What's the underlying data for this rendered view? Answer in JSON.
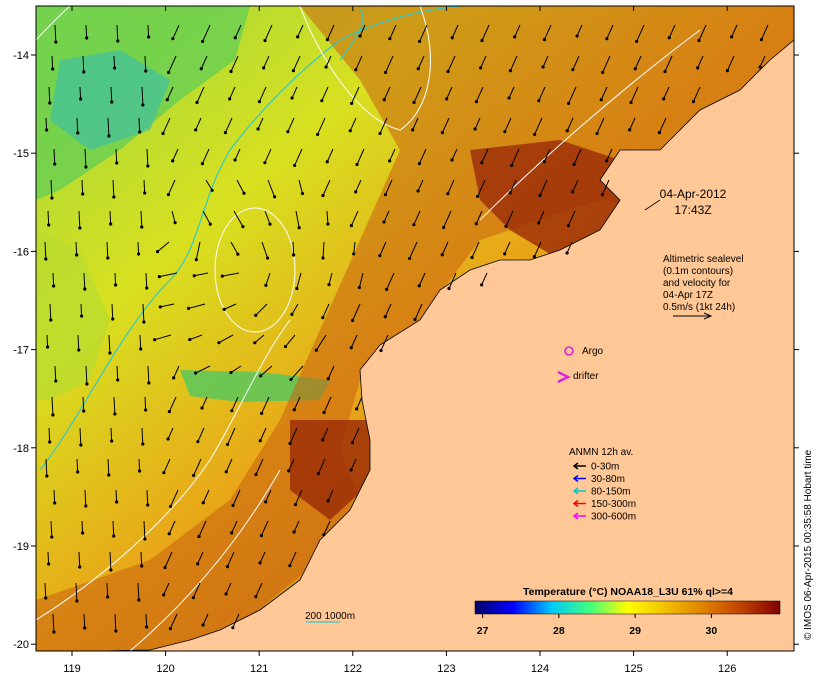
{
  "map": {
    "lon_ticks": [
      "119",
      "120",
      "121",
      "122",
      "123",
      "124",
      "125",
      "126"
    ],
    "lat_ticks": [
      "-14",
      "-15",
      "-16",
      "-17",
      "-18",
      "-19",
      "-20"
    ],
    "date_label": "04-Apr-2012",
    "time_label": "17:43Z",
    "altimetry_note": [
      "Altimetric sealevel",
      "(0.1m contours)",
      "and velocity for",
      "04-Apr 17Z",
      "0.5m/s (1kt 24h)"
    ],
    "argo_label": "Argo",
    "drifter_label": "drifter",
    "isobath_label": "200  1000m",
    "credit": "© IMOS 06-Apr-2015 00:35:58 Hobart time"
  },
  "anmn_legend": {
    "title": "ANMN 12h av.",
    "items": [
      {
        "label": "0-30m",
        "color": "#000000"
      },
      {
        "label": "30-80m",
        "color": "#0000ff"
      },
      {
        "label": "80-150m",
        "color": "#00c8c8"
      },
      {
        "label": "150-300m",
        "color": "#ff0000"
      },
      {
        "label": "300-600m",
        "color": "#ff00ff"
      }
    ]
  },
  "colorbar": {
    "title": "Temperature (°C) NOAA18_L3U 61% ql>=4",
    "ticks": [
      "27",
      "28",
      "29",
      "30"
    ],
    "range": [
      26.9,
      30.9
    ],
    "stops": [
      "#000066",
      "#0000ff",
      "#00c8ff",
      "#40ff80",
      "#ffff00",
      "#f0c000",
      "#e08000",
      "#c04000",
      "#800000"
    ]
  },
  "colors": {
    "land": "#ffc896",
    "arrow": "#000000",
    "contour": "#ffffff",
    "isobath": "#32c8c8",
    "argo": "#e020e0"
  }
}
